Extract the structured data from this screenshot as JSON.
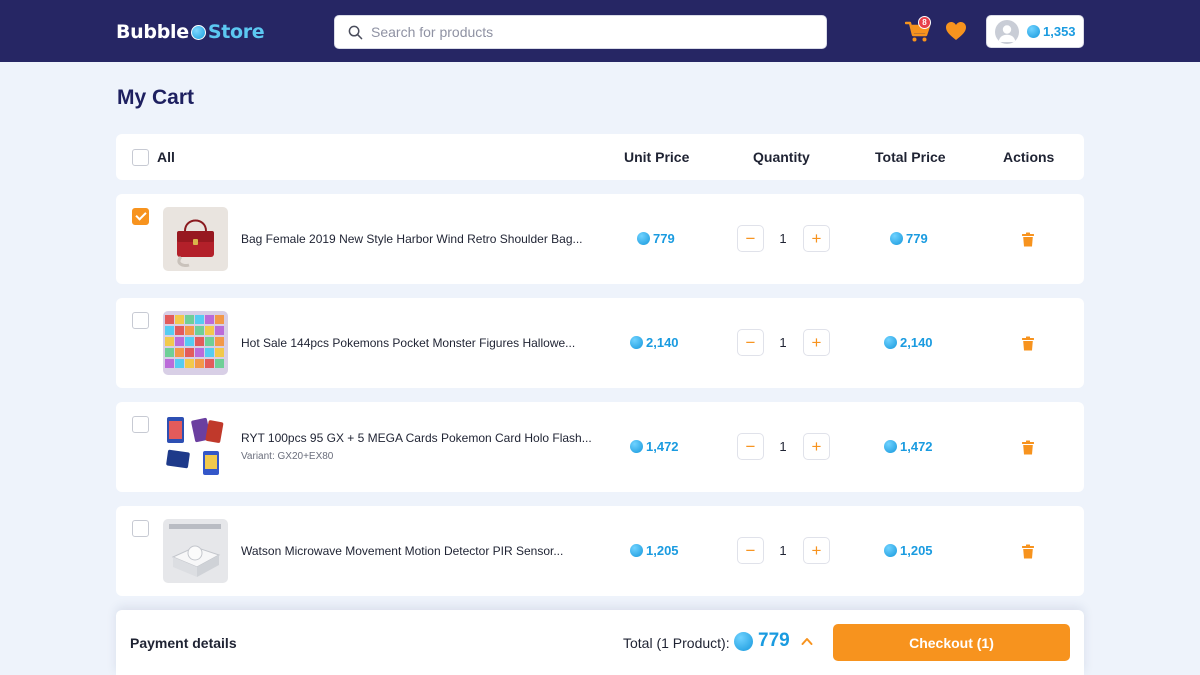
{
  "header": {
    "logo_part1": "Bubble",
    "logo_part2": "Store",
    "search_placeholder": "Search for products",
    "cart_count": "8",
    "balance": "1,353"
  },
  "page_title": "My Cart",
  "table_header": {
    "select_all_label": "All",
    "unit_price": "Unit Price",
    "quantity": "Quantity",
    "total_price": "Total Price",
    "actions": "Actions"
  },
  "items": [
    {
      "name": "Bag Female 2019 New Style Harbor Wind Retro Shoulder Bag...",
      "variant": "",
      "unit_price": "779",
      "quantity": "1",
      "total_price": "779",
      "selected": true,
      "minus": "−",
      "plus": "+"
    },
    {
      "name": "Hot Sale 144pcs Pokemons Pocket Monster Figures Hallowe...",
      "variant": "",
      "unit_price": "2,140",
      "quantity": "1",
      "total_price": "2,140",
      "selected": false,
      "minus": "−",
      "plus": "+"
    },
    {
      "name": "RYT 100pcs 95 GX + 5 MEGA Cards Pokemon Card Holo Flash...",
      "variant": "Variant: GX20+EX80",
      "unit_price": "1,472",
      "quantity": "1",
      "total_price": "1,472",
      "selected": false,
      "minus": "−",
      "plus": "+"
    },
    {
      "name": "Watson Microwave Movement Motion Detector PIR Sensor...",
      "variant": "",
      "unit_price": "1,205",
      "quantity": "1",
      "total_price": "1,205",
      "selected": false,
      "minus": "−",
      "plus": "+"
    }
  ],
  "footer": {
    "payment_details": "Payment details",
    "total_label": "Total (1 Product):",
    "total_amount": "779",
    "checkout_label": "Checkout (1)"
  },
  "colors": {
    "header_bg": "#262664",
    "accent_orange": "#f7931e",
    "coin_blue": "#1a9be0",
    "page_bg": "#eef3fb"
  }
}
